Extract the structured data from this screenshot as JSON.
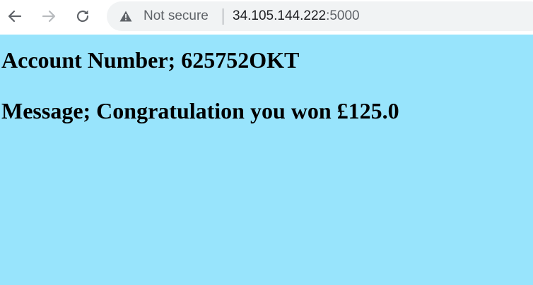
{
  "browser": {
    "nav": {
      "back_icon": "arrow-left-icon",
      "forward_icon": "arrow-right-icon",
      "reload_icon": "reload-icon"
    },
    "address_bar": {
      "security_icon": "warning-triangle-icon",
      "security_label": "Not secure",
      "host": "34.105.144.222",
      "port": ":5000"
    }
  },
  "page": {
    "background_color": "#98e4fc",
    "account_line": "Account Number; 625752OKT",
    "message_line": "Message; Congratulation you won £125.0"
  }
}
